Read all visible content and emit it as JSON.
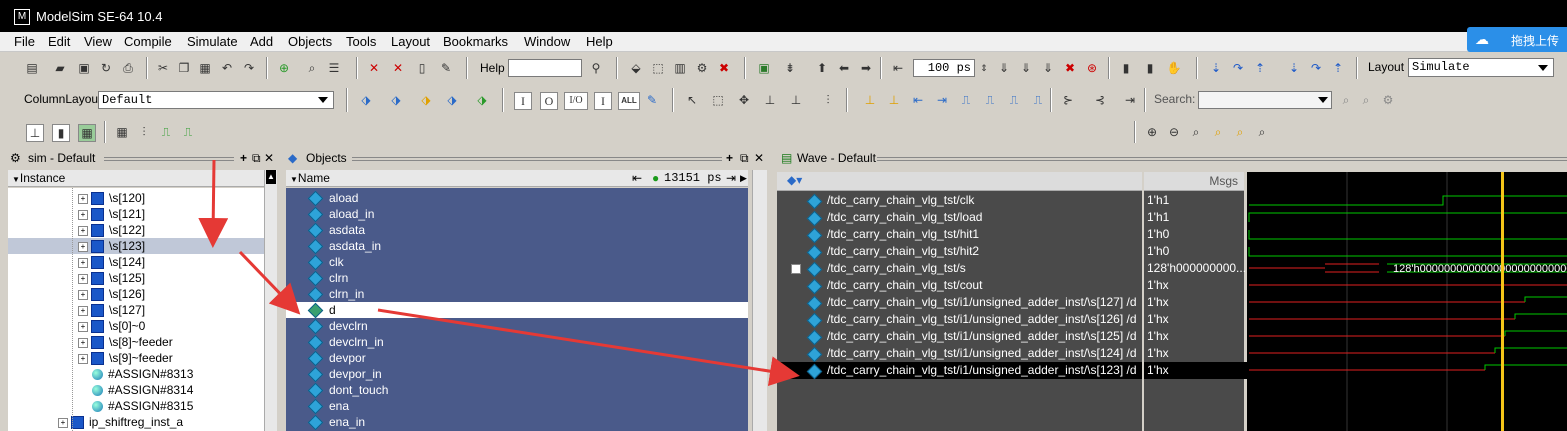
{
  "window": {
    "title": "ModelSim SE-64 10.4"
  },
  "menu": [
    "File",
    "Edit",
    "View",
    "Compile",
    "Simulate",
    "Add",
    "Objects",
    "Tools",
    "Layout",
    "Bookmarks",
    "Window",
    "Help"
  ],
  "upload_button": {
    "label": "拖拽上传"
  },
  "toolbar1": {
    "help_label": "Help",
    "run_length": "100 ps",
    "layout_label": "Layout",
    "layout_value": "Simulate"
  },
  "toolbar2": {
    "columnlayout_label": "ColumnLayout",
    "columnlayout_value": "Default",
    "io_buttons": [
      "I",
      "O",
      "I/O",
      "I",
      "ALL"
    ],
    "search_label": "Search:"
  },
  "sim_pane": {
    "title": "sim - Default",
    "column": "Instance",
    "rows": [
      {
        "label": "\\s[120]",
        "kind": "box",
        "exp": true,
        "indent": 70
      },
      {
        "label": "\\s[121]",
        "kind": "box",
        "exp": true,
        "indent": 70
      },
      {
        "label": "\\s[122]",
        "kind": "box",
        "exp": true,
        "indent": 70
      },
      {
        "label": "\\s[123]",
        "kind": "box",
        "exp": true,
        "indent": 70,
        "selected": true
      },
      {
        "label": "\\s[124]",
        "kind": "box",
        "exp": true,
        "indent": 70
      },
      {
        "label": "\\s[125]",
        "kind": "box",
        "exp": true,
        "indent": 70
      },
      {
        "label": "\\s[126]",
        "kind": "box",
        "exp": true,
        "indent": 70
      },
      {
        "label": "\\s[127]",
        "kind": "box",
        "exp": true,
        "indent": 70
      },
      {
        "label": "\\s[0]~0",
        "kind": "box",
        "exp": true,
        "indent": 70
      },
      {
        "label": "\\s[8]~feeder",
        "kind": "box",
        "exp": true,
        "indent": 70
      },
      {
        "label": "\\s[9]~feeder",
        "kind": "box",
        "exp": true,
        "indent": 70
      },
      {
        "label": "#ASSIGN#8313",
        "kind": "sphere",
        "exp": false,
        "indent": 84
      },
      {
        "label": "#ASSIGN#8314",
        "kind": "sphere",
        "exp": false,
        "indent": 84
      },
      {
        "label": "#ASSIGN#8315",
        "kind": "sphere",
        "exp": false,
        "indent": 84
      },
      {
        "label": "ip_shiftreg_inst_a",
        "kind": "box",
        "exp": true,
        "indent": 50
      }
    ]
  },
  "objects_pane": {
    "title": "Objects",
    "column": "Name",
    "time": "13151 ps",
    "rows": [
      "aload",
      "aload_in",
      "asdata",
      "asdata_in",
      "clk",
      "clrn",
      "clrn_in",
      "d",
      "devclrn",
      "devclrn_in",
      "devpor",
      "devpor_in",
      "dont_touch",
      "ena",
      "ena_in"
    ],
    "selected_index": 7
  },
  "wave_pane": {
    "title": "Wave - Default",
    "msgs_label": "Msgs",
    "signals": [
      {
        "name": "/tdc_carry_chain_vlg_tst/clk",
        "value": "1'h1"
      },
      {
        "name": "/tdc_carry_chain_vlg_tst/load",
        "value": "1'h1"
      },
      {
        "name": "/tdc_carry_chain_vlg_tst/hit1",
        "value": "1'h0"
      },
      {
        "name": "/tdc_carry_chain_vlg_tst/hit2",
        "value": "1'h0"
      },
      {
        "name": "/tdc_carry_chain_vlg_tst/s",
        "value": "128'h000000000..."
      },
      {
        "name": "/tdc_carry_chain_vlg_tst/cout",
        "value": "1'hx"
      },
      {
        "name": "/tdc_carry_chain_vlg_tst/i1/unsigned_adder_inst/\\s[127] /d",
        "value": "1'hx"
      },
      {
        "name": "/tdc_carry_chain_vlg_tst/i1/unsigned_adder_inst/\\s[126] /d",
        "value": "1'hx"
      },
      {
        "name": "/tdc_carry_chain_vlg_tst/i1/unsigned_adder_inst/\\s[125] /d",
        "value": "1'hx"
      },
      {
        "name": "/tdc_carry_chain_vlg_tst/i1/unsigned_adder_inst/\\s[124] /d",
        "value": "1'hx"
      },
      {
        "name": "/tdc_carry_chain_vlg_tst/i1/unsigned_adder_inst/\\s[123] /d",
        "value": "1'hx"
      }
    ],
    "bus_value": "128'h0000000000000000000000000",
    "selected_index": 10
  },
  "colors": {
    "wave_bg": "#000000",
    "objects_bg": "#4a5a8a",
    "green": "#00c800",
    "red": "#e02020",
    "cursor": "#f5c518",
    "annotation": "#e53935"
  }
}
